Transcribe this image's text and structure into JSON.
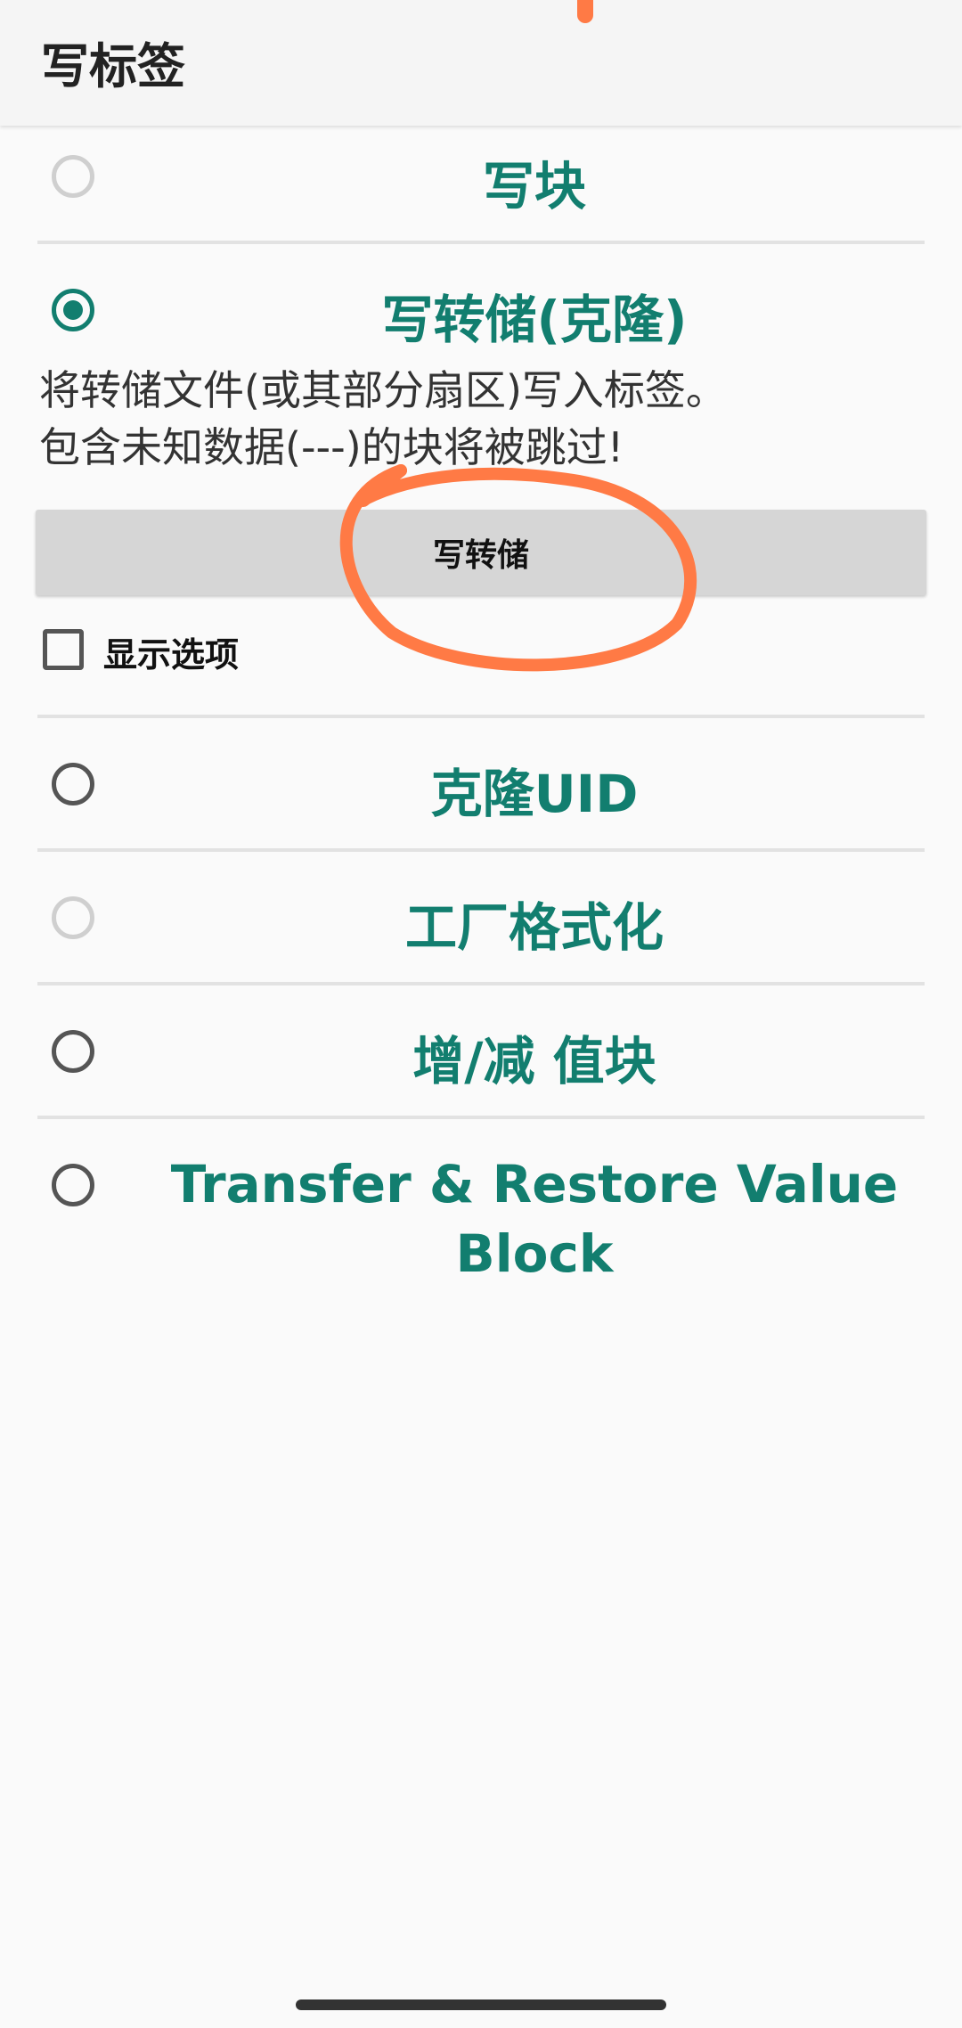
{
  "appbar": {
    "title": "写标签"
  },
  "options": {
    "write_block": {
      "label": "写块",
      "state": "disabled"
    },
    "write_dump": {
      "label": "写转储(克隆)",
      "state": "checked",
      "description_line1": "将转储文件(或其部分扇区)写入标签。",
      "description_line2": "包含未知数据(---)的块将被跳过!",
      "button_label": "写转储",
      "show_options_label": "显示选项"
    },
    "clone_uid": {
      "label": "克隆UID",
      "state": "unchecked"
    },
    "factory_format": {
      "label": "工厂格式化",
      "state": "disabled"
    },
    "value_block": {
      "label": "增/减 值块",
      "state": "unchecked"
    },
    "transfer_restore": {
      "label_line1": "Transfer & Restore Value",
      "label_line2": "Block",
      "state": "unchecked"
    }
  },
  "colors": {
    "accent": "#127e6f",
    "annotation": "#ff7a45"
  }
}
